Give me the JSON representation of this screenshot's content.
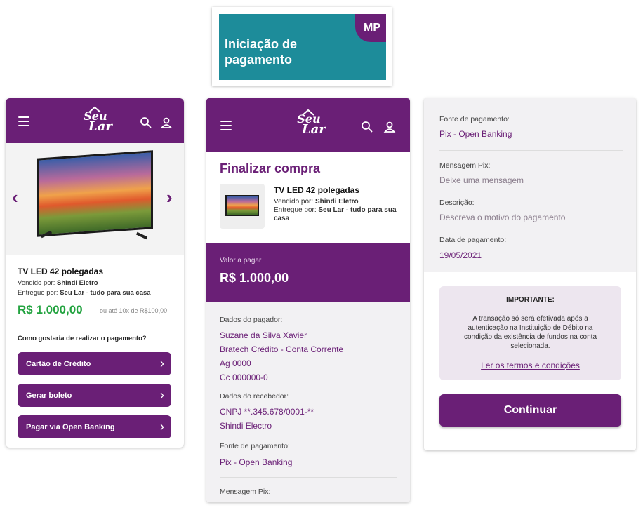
{
  "badge": {
    "corner": "MP",
    "title_line1": "Iniciação de",
    "title_line2": "pagamento"
  },
  "brand": {
    "line1": "Seu",
    "line2": "Lar"
  },
  "product": {
    "name": "TV LED 42 polegadas",
    "sold_by_label": "Vendido por:",
    "sold_by": "Shindi Eletro",
    "delivered_by_label": "Entregue por:",
    "delivered_by": "Seu Lar - tudo para sua casa"
  },
  "screen1": {
    "price": "R$ 1.000,00",
    "installments": "ou até 10x de R$100,00",
    "question": "Como gostaria de realizar o pagamento?",
    "buttons": [
      "Cartão de Crédito",
      "Gerar boleto",
      "Pagar via Open Banking"
    ]
  },
  "screen2": {
    "title": "Finalizar compra",
    "valor_label": "Valor a pagar",
    "valor": "R$ 1.000,00",
    "payer_label": "Dados do pagador:",
    "payer": [
      "Suzane da Silva Xavier",
      "Bratech Crédito - Conta Corrente",
      "Ag 0000",
      "Cc 000000-0"
    ],
    "receiver_label": "Dados do recebedor:",
    "receiver": [
      "CNPJ **.345.678/0001-**",
      "Shindi Electro"
    ],
    "source_label": "Fonte de pagamento:",
    "source": "Pix - Open Banking",
    "message_label": "Mensagem Pix:"
  },
  "screen3": {
    "source_label": "Fonte de pagamento:",
    "source": "Pix - Open Banking",
    "message_label": "Mensagem Pix:",
    "message_placeholder": "Deixe uma mensagem",
    "description_label": "Descrição:",
    "description_placeholder": "Descreva o motivo do pagamento",
    "date_label": "Data de pagamento:",
    "date": "19/05/2021",
    "important_title": "IMPORTANTE:",
    "important_text": "A transação só será efetivada após a autenticação na Instituição de Débito na condição da existência de fundos na conta selecionada.",
    "terms_link": "Ler os termos e condições",
    "continue": "Continuar"
  },
  "colors": {
    "brand_purple": "#6a1f76",
    "teal": "#1d8c9a",
    "price_green": "#23a340"
  }
}
